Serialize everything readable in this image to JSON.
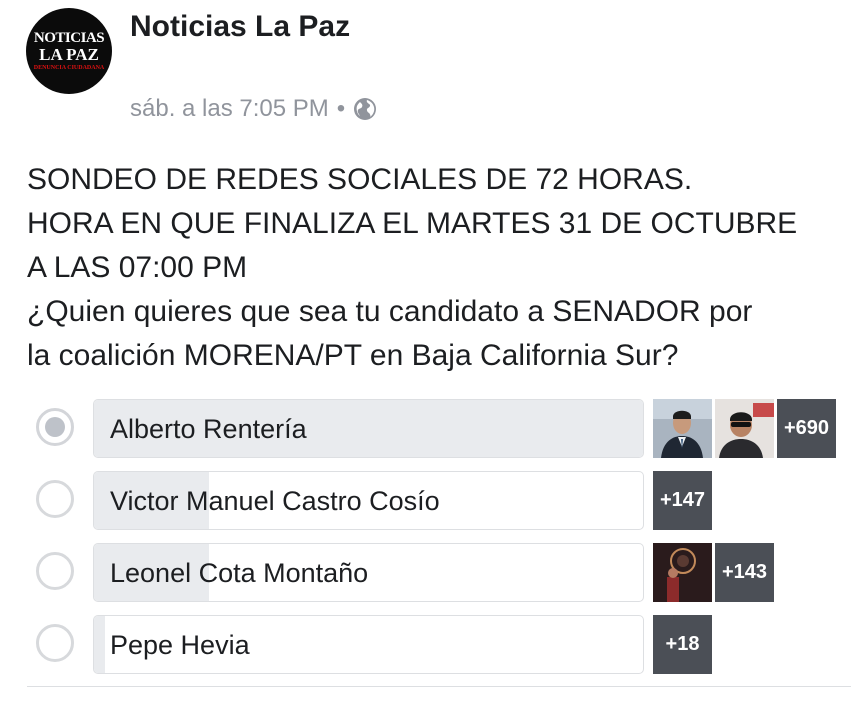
{
  "post": {
    "page_name": "Noticias La Paz",
    "avatar": {
      "line1": "NOTICIAS",
      "line2": "LA PAZ",
      "line3": "DENUNCIA CIUDADANA"
    },
    "timestamp": "sáb. a las 7:05 PM",
    "separator": "•",
    "privacy_icon": "globe-icon",
    "text_lines": [
      "SONDEO DE REDES SOCIALES DE 72 HORAS.",
      "HORA EN QUE FINALIZA EL MARTES 31 DE OCTUBRE",
      "A LAS 07:00 PM",
      "¿Quien quieres que sea tu candidato a SENADOR por",
      "la coalición MORENA/PT en Baja California Sur?"
    ]
  },
  "poll": {
    "options": [
      {
        "label": "Alberto Rentería",
        "selected": true,
        "fill_percent": 100,
        "voter_avatars": 2,
        "more_count": "+690"
      },
      {
        "label": "Victor Manuel Castro Cosío",
        "selected": false,
        "fill_percent": 21,
        "voter_avatars": 0,
        "more_count": "+147"
      },
      {
        "label": "Leonel Cota Montaño",
        "selected": false,
        "fill_percent": 21,
        "voter_avatars": 1,
        "more_count": "+143"
      },
      {
        "label": "Pepe Hevia",
        "selected": false,
        "fill_percent": 2,
        "voter_avatars": 0,
        "more_count": "+18"
      }
    ]
  },
  "colors": {
    "text": "#1c1e21",
    "meta": "#90949c",
    "bar_fill": "#e9ebee",
    "count_bg": "#4b4f56"
  }
}
